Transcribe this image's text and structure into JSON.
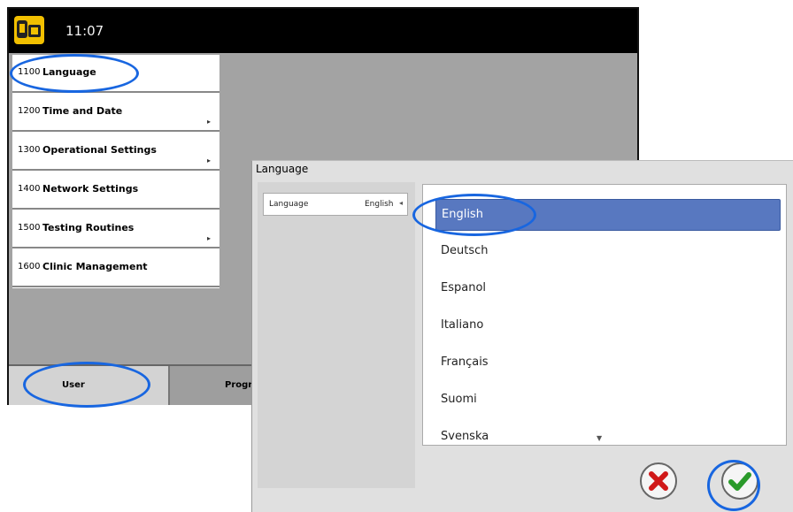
{
  "status_bar": {
    "time": "11:07",
    "icon": "app-logo-icon"
  },
  "menu": {
    "items": [
      {
        "code": "1100",
        "label": "Language",
        "has_arrow": false
      },
      {
        "code": "1200",
        "label": "Time and Date",
        "has_arrow": true
      },
      {
        "code": "1300",
        "label": "Operational Settings",
        "has_arrow": true
      },
      {
        "code": "1400",
        "label": "Network Settings",
        "has_arrow": false
      },
      {
        "code": "1500",
        "label": "Testing Routines",
        "has_arrow": true
      },
      {
        "code": "1600",
        "label": "Clinic Management",
        "has_arrow": false
      }
    ],
    "arrow_glyph": "▸"
  },
  "tabs": {
    "user": "User",
    "prog": "Progr"
  },
  "dialog": {
    "title": "Language",
    "setting_label": "Language",
    "setting_value": "English",
    "setting_glyph": "◂",
    "options": [
      "English",
      "Deutsch",
      "Espanol",
      "Italiano",
      "Français",
      "Suomi",
      "Svenska"
    ],
    "selected": "English",
    "scroll_glyph": "▼",
    "cancel_icon": "cancel-x-icon",
    "confirm_icon": "confirm-check-icon"
  },
  "colors": {
    "highlight": "#1866e0",
    "selected_bg": "#5878c0",
    "cancel_red": "#d01818",
    "confirm_green": "#2a9a2a",
    "logo_yellow": "#f2c000"
  }
}
